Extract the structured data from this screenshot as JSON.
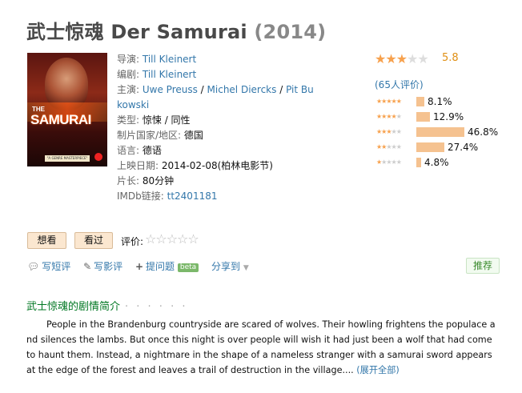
{
  "title": {
    "cn": "武士惊魂",
    "en": "Der Samurai",
    "year": "(2014)"
  },
  "poster": {
    "the": "THE",
    "title": "SAMURAI",
    "quote": "\"A GENRE MASTERPIECE\""
  },
  "info": {
    "director_label": "导演:",
    "director": "Till Kleinert",
    "writer_label": "编剧:",
    "writer": "Till Kleinert",
    "cast_label": "主演:",
    "cast": [
      "Uwe Preuss",
      "Michel Diercks",
      "Pit Bukowski"
    ],
    "cast_sep": " / ",
    "genre_label": "类型:",
    "genre": "惊悚 / 同性",
    "country_label": "制片国家/地区:",
    "country": "德国",
    "language_label": "语言:",
    "language": "德语",
    "release_label": "上映日期:",
    "release": "2014-02-08(柏林电影节)",
    "runtime_label": "片长:",
    "runtime": "80分钟",
    "imdb_label": "IMDb链接:",
    "imdb": "tt2401181"
  },
  "rating": {
    "score": "5.8",
    "stars_filled": 3,
    "votes_text": "(65人评价)",
    "breakdown": [
      {
        "stars": 5,
        "percent": 8.1,
        "label": "8.1%"
      },
      {
        "stars": 4,
        "percent": 12.9,
        "label": "12.9%"
      },
      {
        "stars": 3,
        "percent": 46.8,
        "label": "46.8%"
      },
      {
        "stars": 2,
        "percent": 27.4,
        "label": "27.4%"
      },
      {
        "stars": 1,
        "percent": 4.8,
        "label": "4.8%"
      }
    ]
  },
  "buttons": {
    "want": "想看",
    "seen": "看过",
    "rate_label": "评价:"
  },
  "actions": {
    "short_review": "写短评",
    "review": "写影评",
    "ask": "提问题",
    "beta": "beta",
    "share": "分享到",
    "recommend": "推荐"
  },
  "synopsis": {
    "title": "武士惊魂的剧情简介",
    "dots": "· · · · · ·",
    "text": "People in the Brandenburg countryside are scared of wolves. Their howling frightens the populace and silences the lambs. But once this night is over people will wish it had just been a wolf that had come to haunt them. Instead, a nightmare in the shape of a nameless stranger with a samurai sword appears at the edge of the forest and leaves a trail of destruction in the village....",
    "expand": "(展开全部)"
  },
  "colors": {
    "star": "#f7a14d",
    "score": "#e09015",
    "link": "#3377aa",
    "green_title": "#007722",
    "bar": "#f5c290"
  }
}
